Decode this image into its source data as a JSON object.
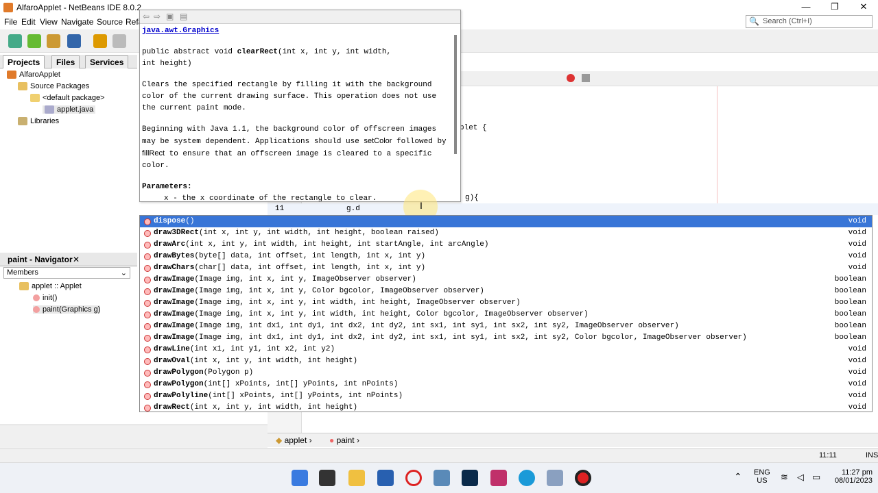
{
  "window": {
    "title": "AlfaroApplet - NetBeans IDE 8.0.2",
    "minimize": "—",
    "maximize": "❐",
    "close": "✕"
  },
  "menu": {
    "file": "File",
    "edit": "Edit",
    "view": "View",
    "navigate": "Navigate",
    "source": "Source",
    "refactor": "Refa"
  },
  "search": {
    "placeholder": "Search (Ctrl+I)"
  },
  "tabs": {
    "projects": "Projects",
    "files": "Files",
    "services": "Services"
  },
  "tree": {
    "project": "AlfaroApplet",
    "source_packages": "Source Packages",
    "default_package": "<default package>",
    "file": "applet.java",
    "libraries": "Libraries"
  },
  "navigator": {
    "title": "paint - Navigator",
    "members": "Members",
    "class_node": "applet :: Applet",
    "init": "init()",
    "paint": "paint(Graphics g)"
  },
  "editor": {
    "line_number": "11",
    "current_code": "g.d",
    "snippet_applet": "plet {",
    "snippet_g": "g){"
  },
  "javadoc": {
    "class_link": "java.awt.Graphics",
    "signature_prefix": "public abstract void ",
    "signature_name": "clearRect",
    "signature_rest": "(int x, int y, int width,",
    "signature_line2": "int height)",
    "para1": "Clears the specified rectangle by filling it with the background color of the current drawing surface. This operation does not use the current paint mode.",
    "para2a": "Beginning with Java 1.1, the background color of offscreen images may be system dependent. Applications should use",
    "para2b_set": "setColor",
    "para2b_mid": " followed by ",
    "para2b_fill": "fillRect",
    "para2b_end": " to ensure that an offscreen image is cleared to a specific color.",
    "parameters_label": "Parameters:",
    "param_x": "x - the x coordinate of the rectangle to clear."
  },
  "completion": [
    {
      "name": "dispose",
      "params": "()",
      "type": "void",
      "selected": true
    },
    {
      "name": "draw3DRect",
      "params": "(int x, int y, int width, int height, boolean raised)",
      "type": "void"
    },
    {
      "name": "drawArc",
      "params": "(int x, int y, int width, int height, int startAngle, int arcAngle)",
      "type": "void"
    },
    {
      "name": "drawBytes",
      "params": "(byte[] data, int offset, int length, int x, int y)",
      "type": "void"
    },
    {
      "name": "drawChars",
      "params": "(char[] data, int offset, int length, int x, int y)",
      "type": "void"
    },
    {
      "name": "drawImage",
      "params": "(Image img, int x, int y, ImageObserver observer)",
      "type": "boolean"
    },
    {
      "name": "drawImage",
      "params": "(Image img, int x, int y, Color bgcolor, ImageObserver observer)",
      "type": "boolean"
    },
    {
      "name": "drawImage",
      "params": "(Image img, int x, int y, int width, int height, ImageObserver observer)",
      "type": "boolean"
    },
    {
      "name": "drawImage",
      "params": "(Image img, int x, int y, int width, int height, Color bgcolor, ImageObserver observer)",
      "type": "boolean"
    },
    {
      "name": "drawImage",
      "params": "(Image img, int dx1, int dy1, int dx2, int dy2, int sx1, int sy1, int sx2, int sy2, ImageObserver observer)",
      "type": "boolean"
    },
    {
      "name": "drawImage",
      "params": "(Image img, int dx1, int dy1, int dx2, int dy2, int sx1, int sy1, int sx2, int sy2, Color bgcolor, ImageObserver observer)",
      "type": "boolean"
    },
    {
      "name": "drawLine",
      "params": "(int x1, int y1, int x2, int y2)",
      "type": "void"
    },
    {
      "name": "drawOval",
      "params": "(int x, int y, int width, int height)",
      "type": "void"
    },
    {
      "name": "drawPolygon",
      "params": "(Polygon p)",
      "type": "void"
    },
    {
      "name": "drawPolygon",
      "params": "(int[] xPoints, int[] yPoints, int nPoints)",
      "type": "void"
    },
    {
      "name": "drawPolyline",
      "params": "(int[] xPoints, int[] yPoints, int nPoints)",
      "type": "void"
    },
    {
      "name": "drawRect",
      "params": "(int x, int y, int width, int height)",
      "type": "void"
    }
  ],
  "breadcrumb": {
    "class": "applet",
    "method": "paint"
  },
  "status": {
    "position": "11:11",
    "mode": "INS"
  },
  "systray": {
    "lang1": "ENG",
    "lang2": "US",
    "time": "11:27 pm",
    "date": "08/01/2023"
  }
}
